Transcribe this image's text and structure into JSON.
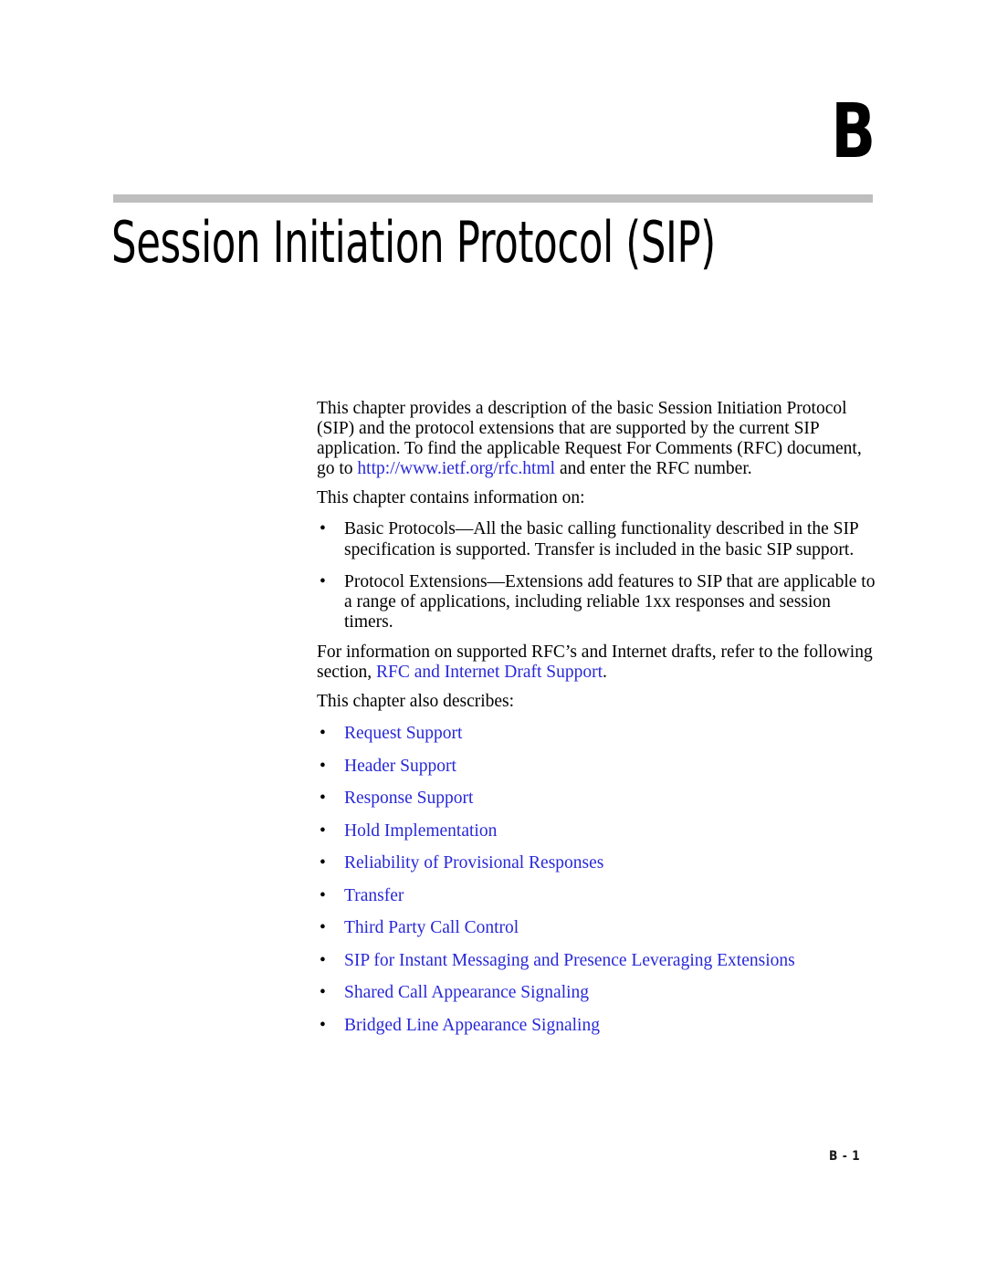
{
  "page": {
    "chapter_letter": "B",
    "title": "Session Initiation Protocol (SIP)",
    "footer_page_number": "B - 1",
    "rule_color": "#bebebe",
    "link_color": "#2828d8",
    "text_color": "#000000"
  },
  "intro": {
    "paragraph_part1": "This chapter provides a description of the basic Session Initiation Protocol (SIP) and the protocol extensions that are supported by the current SIP application. To find the applicable Request For Comments (RFC) document, go to ",
    "url_text": "http://www.ietf.org/rfc.html",
    "paragraph_part2": " and enter the RFC number.",
    "contains_line": "This chapter contains information on:"
  },
  "topics": [
    {
      "term": "Basic Protocols",
      "separator": "—",
      "description": "All the basic calling functionality described in the SIP specification is supported. Transfer is included in the basic SIP support."
    },
    {
      "term": "Protocol Extensions",
      "separator": "—",
      "description": "Extensions add features to SIP that are applicable to a range of applications, including reliable 1xx responses and session timers."
    }
  ],
  "reference": {
    "text_before": "For information on supported RFC’s and Internet drafts, refer to the following section, ",
    "link_text": "RFC and Internet Draft Support",
    "text_after": ".",
    "describes_line": "This chapter also describes:"
  },
  "describes_links": [
    {
      "label": "Request Support"
    },
    {
      "label": "Header Support"
    },
    {
      "label": "Response Support"
    },
    {
      "label": "Hold Implementation"
    },
    {
      "label": "Reliability of Provisional Responses"
    },
    {
      "label": "Transfer"
    },
    {
      "label": "Third Party Call Control"
    },
    {
      "label": "SIP for Instant Messaging and Presence Leveraging Extensions"
    },
    {
      "label": "Shared Call Appearance Signaling"
    },
    {
      "label": "Bridged Line Appearance Signaling"
    }
  ],
  "bullet_glyph": "•"
}
